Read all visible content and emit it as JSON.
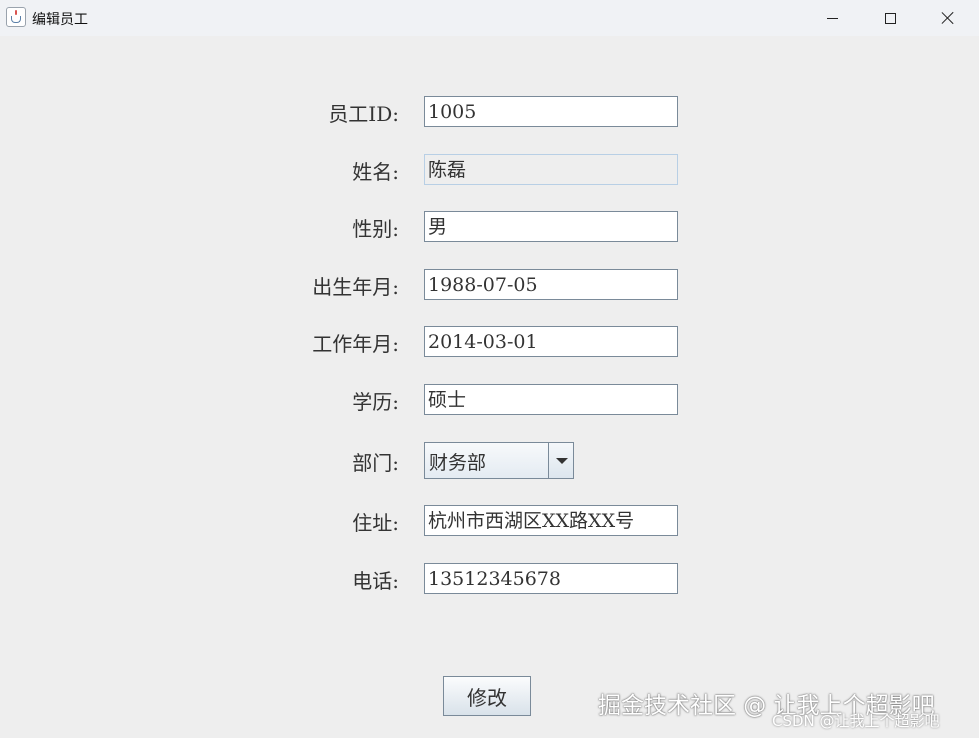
{
  "window": {
    "title": "编辑员工",
    "app_icon": "java-cup-icon",
    "controls": [
      "minimize-icon",
      "maximize-icon",
      "close-icon"
    ]
  },
  "form": {
    "employee_id": {
      "label": "员工ID:",
      "value": "1005"
    },
    "name": {
      "label": "姓名:",
      "value": "陈磊"
    },
    "gender": {
      "label": "性别:",
      "value": "男"
    },
    "birth_date": {
      "label": "出生年月:",
      "value": "1988-07-05"
    },
    "work_date": {
      "label": "工作年月:",
      "value": "2014-03-01"
    },
    "education": {
      "label": "学历:",
      "value": "硕士"
    },
    "department": {
      "label": "部门:",
      "value": "财务部"
    },
    "address": {
      "label": "住址:",
      "value": "杭州市西湖区XX路XX号"
    },
    "phone": {
      "label": "电话:",
      "value": "13512345678"
    }
  },
  "submit_label": "修改",
  "watermark": {
    "main": "掘金技术社区 @ 让我上个超影吧",
    "sub": "CSDN @让我上个超影吧"
  }
}
